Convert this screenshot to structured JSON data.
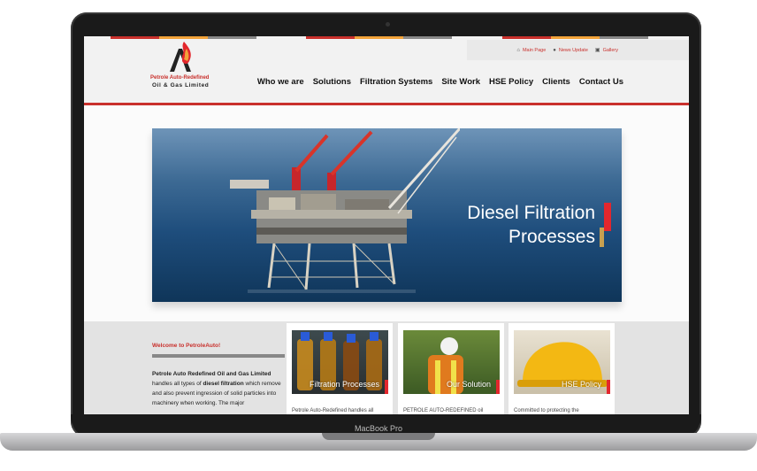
{
  "laptop": {
    "brand_label": "MacBook Pro"
  },
  "site": {
    "logo": {
      "line1": "Petrole Auto-Redefined",
      "line2": "Oil & Gas Limited"
    },
    "utility": [
      {
        "icon": "home-icon",
        "glyph": "⌂",
        "label": "Main Page"
      },
      {
        "icon": "user-icon",
        "glyph": "●",
        "label": "News Update"
      },
      {
        "icon": "image-icon",
        "glyph": "▣",
        "label": "Gallery"
      }
    ],
    "nav": [
      "Who we are",
      "Solutions",
      "Filtration Systems",
      "Site Work",
      "HSE Policy",
      "Clients",
      "Contact Us"
    ],
    "hero": {
      "title_line1": "Diesel Filtration",
      "title_line2": "Processes"
    },
    "welcome": {
      "title": "Welcome to PetroleAuto!",
      "text_a": "Petrole Auto Redefined Oil and Gas Limited",
      "text_b": " handles all types of ",
      "text_c": "diesel filtration",
      "text_d": " which remove and also prevent ingression of solid particles into machinery when working. The major"
    },
    "cards": [
      {
        "label": "Filtration Processes",
        "text": "Petrole Auto-Redefined handles all"
      },
      {
        "label": "Our Solution",
        "text": "PETROLE AUTO-REDEFINED oil"
      },
      {
        "label": "HSE Policy",
        "text": "Committed to protecting the"
      }
    ],
    "colors": {
      "accent_red": "#c9302c",
      "accent_orange": "#f2a33a",
      "accent_gold": "#c8a050"
    }
  }
}
